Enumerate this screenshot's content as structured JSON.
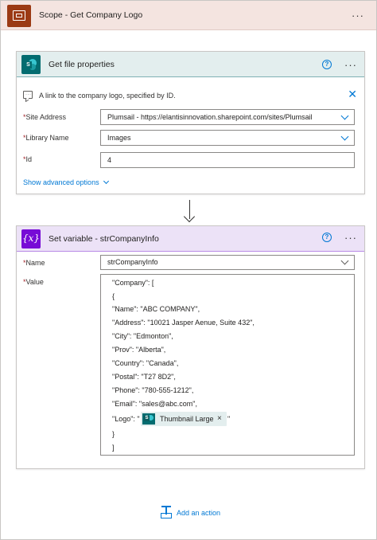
{
  "scope": {
    "title": "Scope - Get Company Logo",
    "more_label": "···"
  },
  "get_file": {
    "title": "Get file properties",
    "help_label": "?",
    "more_label": "···",
    "description": "A link to the company logo, specified by ID.",
    "close_label": "✕",
    "fields": {
      "site_address": {
        "label": "Site Address",
        "value": "Plumsail - https://elantisinnovation.sharepoint.com/sites/Plumsail"
      },
      "library_name": {
        "label": "Library Name",
        "value": "Images"
      },
      "id": {
        "label": "Id",
        "value": "4"
      }
    },
    "advanced_label": "Show advanced options"
  },
  "set_variable": {
    "icon_label": "{x}",
    "title": "Set variable - strCompanyInfo",
    "help_label": "?",
    "more_label": "···",
    "name_label": "Name",
    "name_value": "strCompanyInfo",
    "value_label": "Value",
    "value_lines": [
      "\"Company\":  [",
      "{",
      "\"Name\": \"ABC COMPANY\",",
      "\"Address\": \"10021 Jasper Aenue, Suite 432\",",
      "\"City\": \"Edmonton\",",
      "\"Prov\": \"Alberta\",",
      "\"Country\": \"Canada\",",
      "\"Postal\": \"T27 8D2\",",
      "\"Phone\": \"780-555-1212\",",
      "\"Email\": \"sales@abc.com\",",
      "\"Logo\": \"",
      "}",
      "]"
    ],
    "logo_suffix": "\"",
    "token_label": "Thumbnail Large",
    "token_remove": "×"
  },
  "required_marker": "*",
  "add_action_label": "Add an action",
  "colors": {
    "scope_accent": "#9b3a14",
    "sharepoint": "#036c70",
    "variable": "#770bd6",
    "link": "#0078d4"
  }
}
